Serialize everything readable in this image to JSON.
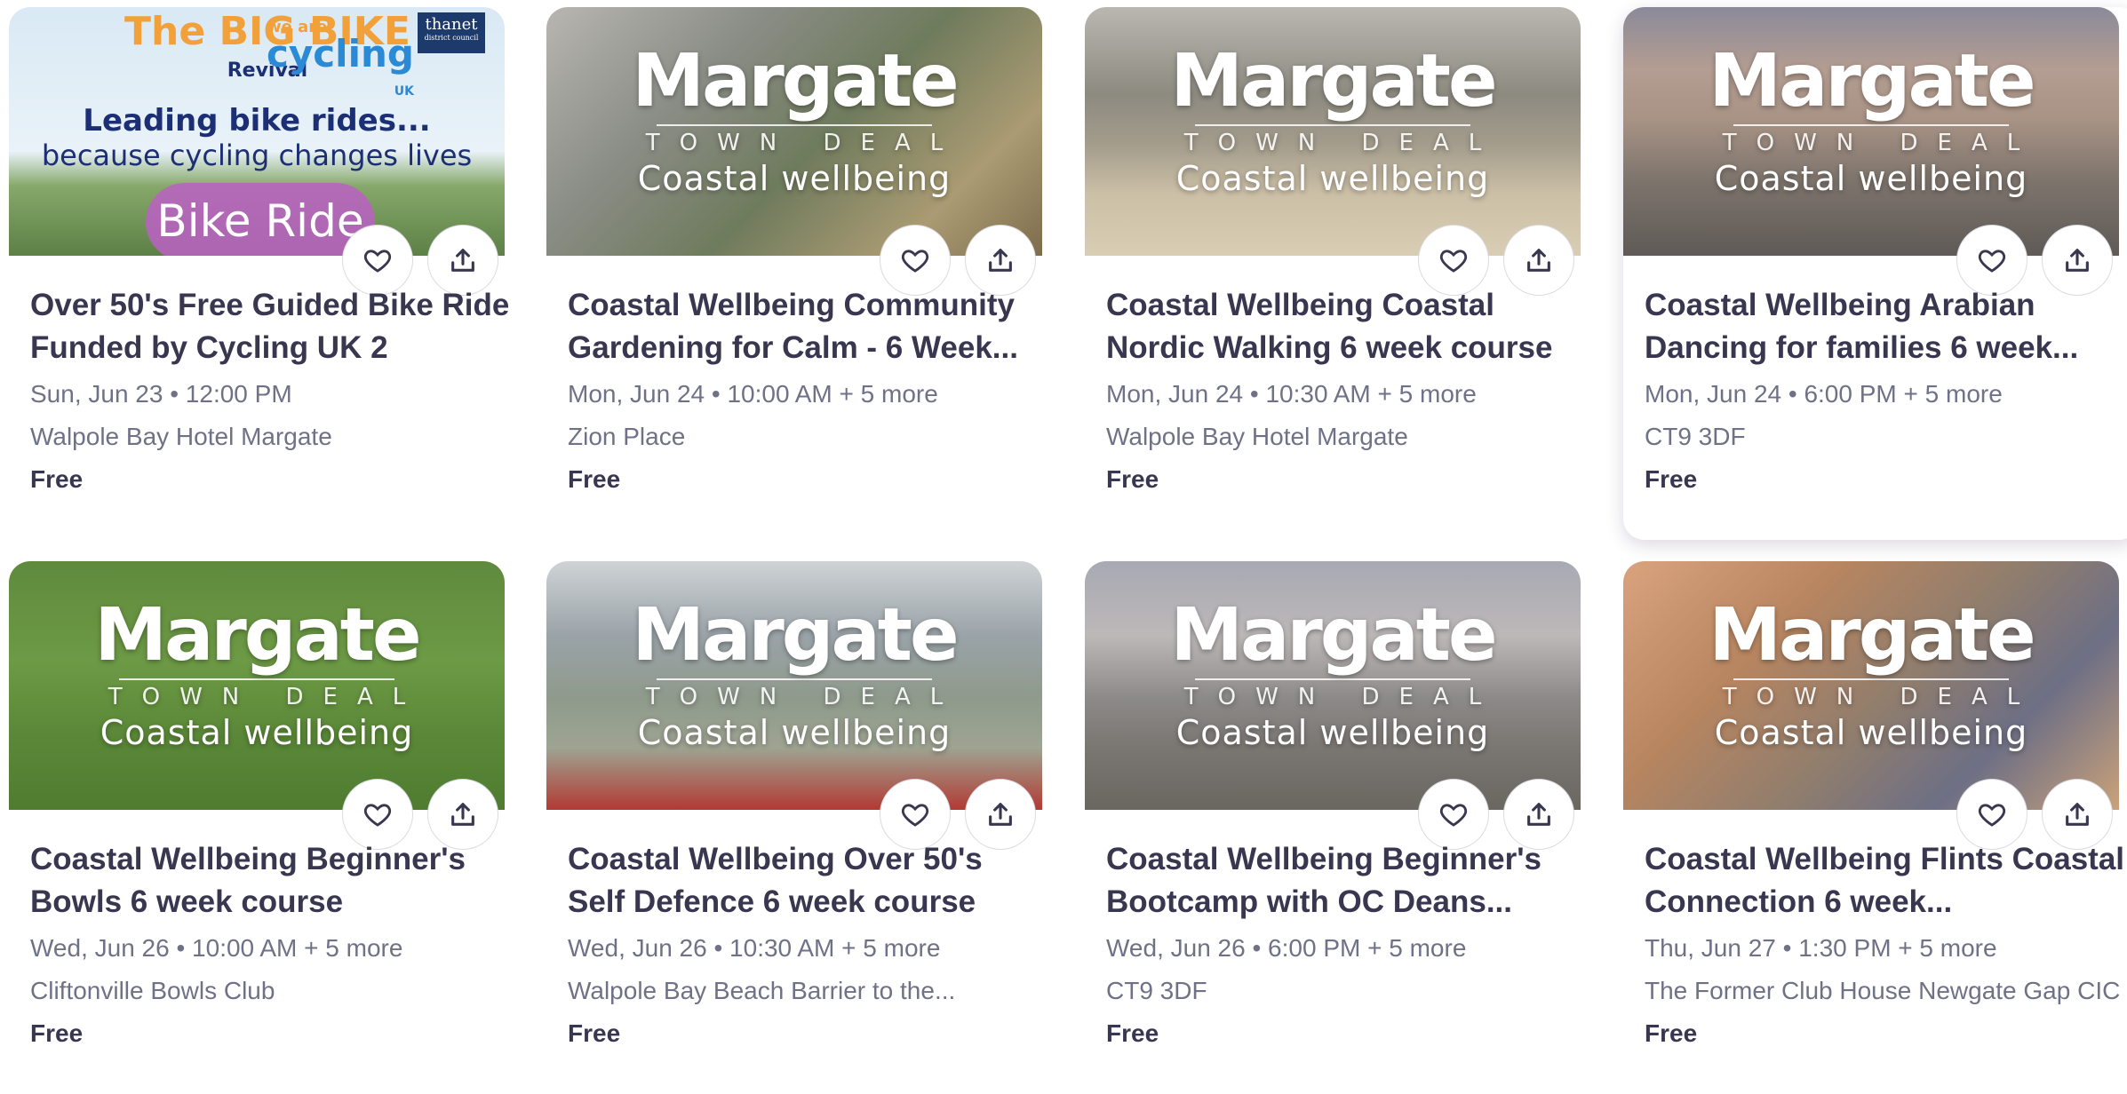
{
  "brand": {
    "word": "Margate",
    "sub": "TOWN DEAL",
    "script": "Coastal wellbeing"
  },
  "bike_promo": {
    "logo_left": "The BIG BIKE",
    "logo_left_sub": "Revival",
    "logo_mid_top": "we are",
    "logo_mid": "cycling",
    "logo_mid_sub": "UK",
    "logo_right": "thanet",
    "logo_right_sub": "district council",
    "heading": "Leading bike rides...",
    "subheading": "because cycling changes lives",
    "pill": "Bike Ride"
  },
  "colors": {
    "title": "#39364f",
    "meta": "#6f7287",
    "button_border": "#dbdae3"
  },
  "icons": {
    "like": "heart-outline-icon",
    "share": "share-upload-icon"
  },
  "events": [
    {
      "title": "Over 50's Free Guided Bike Ride Funded by Cycling UK 2",
      "date": "Sun, Jun 23 • 12:00 PM",
      "venue": "Walpole Bay Hotel Margate",
      "price": "Free"
    },
    {
      "title": "Coastal Wellbeing Community Gardening for Calm - 6 Week...",
      "date": "Mon, Jun 24 • 10:00 AM + 5 more",
      "venue": "Zion Place",
      "price": "Free"
    },
    {
      "title": "Coastal Wellbeing Coastal Nordic Walking 6 week course",
      "date": "Mon, Jun 24 • 10:30 AM + 5 more",
      "venue": "Walpole Bay Hotel Margate",
      "price": "Free"
    },
    {
      "title": "Coastal Wellbeing Arabian Dancing for families 6 week...",
      "date": "Mon, Jun 24 • 6:00 PM + 5 more",
      "venue": "CT9 3DF",
      "price": "Free"
    },
    {
      "title": "Coastal Wellbeing Beginner's Bowls 6 week course",
      "date": "Wed, Jun 26 • 10:00 AM + 5 more",
      "venue": "Cliftonville Bowls Club",
      "price": "Free"
    },
    {
      "title": "Coastal Wellbeing Over 50's Self Defence 6 week course",
      "date": "Wed, Jun 26 • 10:30 AM + 5 more",
      "venue": "Walpole Bay Beach Barrier to the...",
      "price": "Free"
    },
    {
      "title": "Coastal Wellbeing Beginner's Bootcamp with OC Deans...",
      "date": "Wed, Jun 26 • 6:00 PM + 5 more",
      "venue": "CT9 3DF",
      "price": "Free"
    },
    {
      "title": "Coastal Wellbeing Flints Coastal Connection 6 week...",
      "date": "Thu, Jun 27 • 1:30 PM + 5 more",
      "venue": "The Former Club House Newgate Gap CIC",
      "price": "Free"
    }
  ]
}
